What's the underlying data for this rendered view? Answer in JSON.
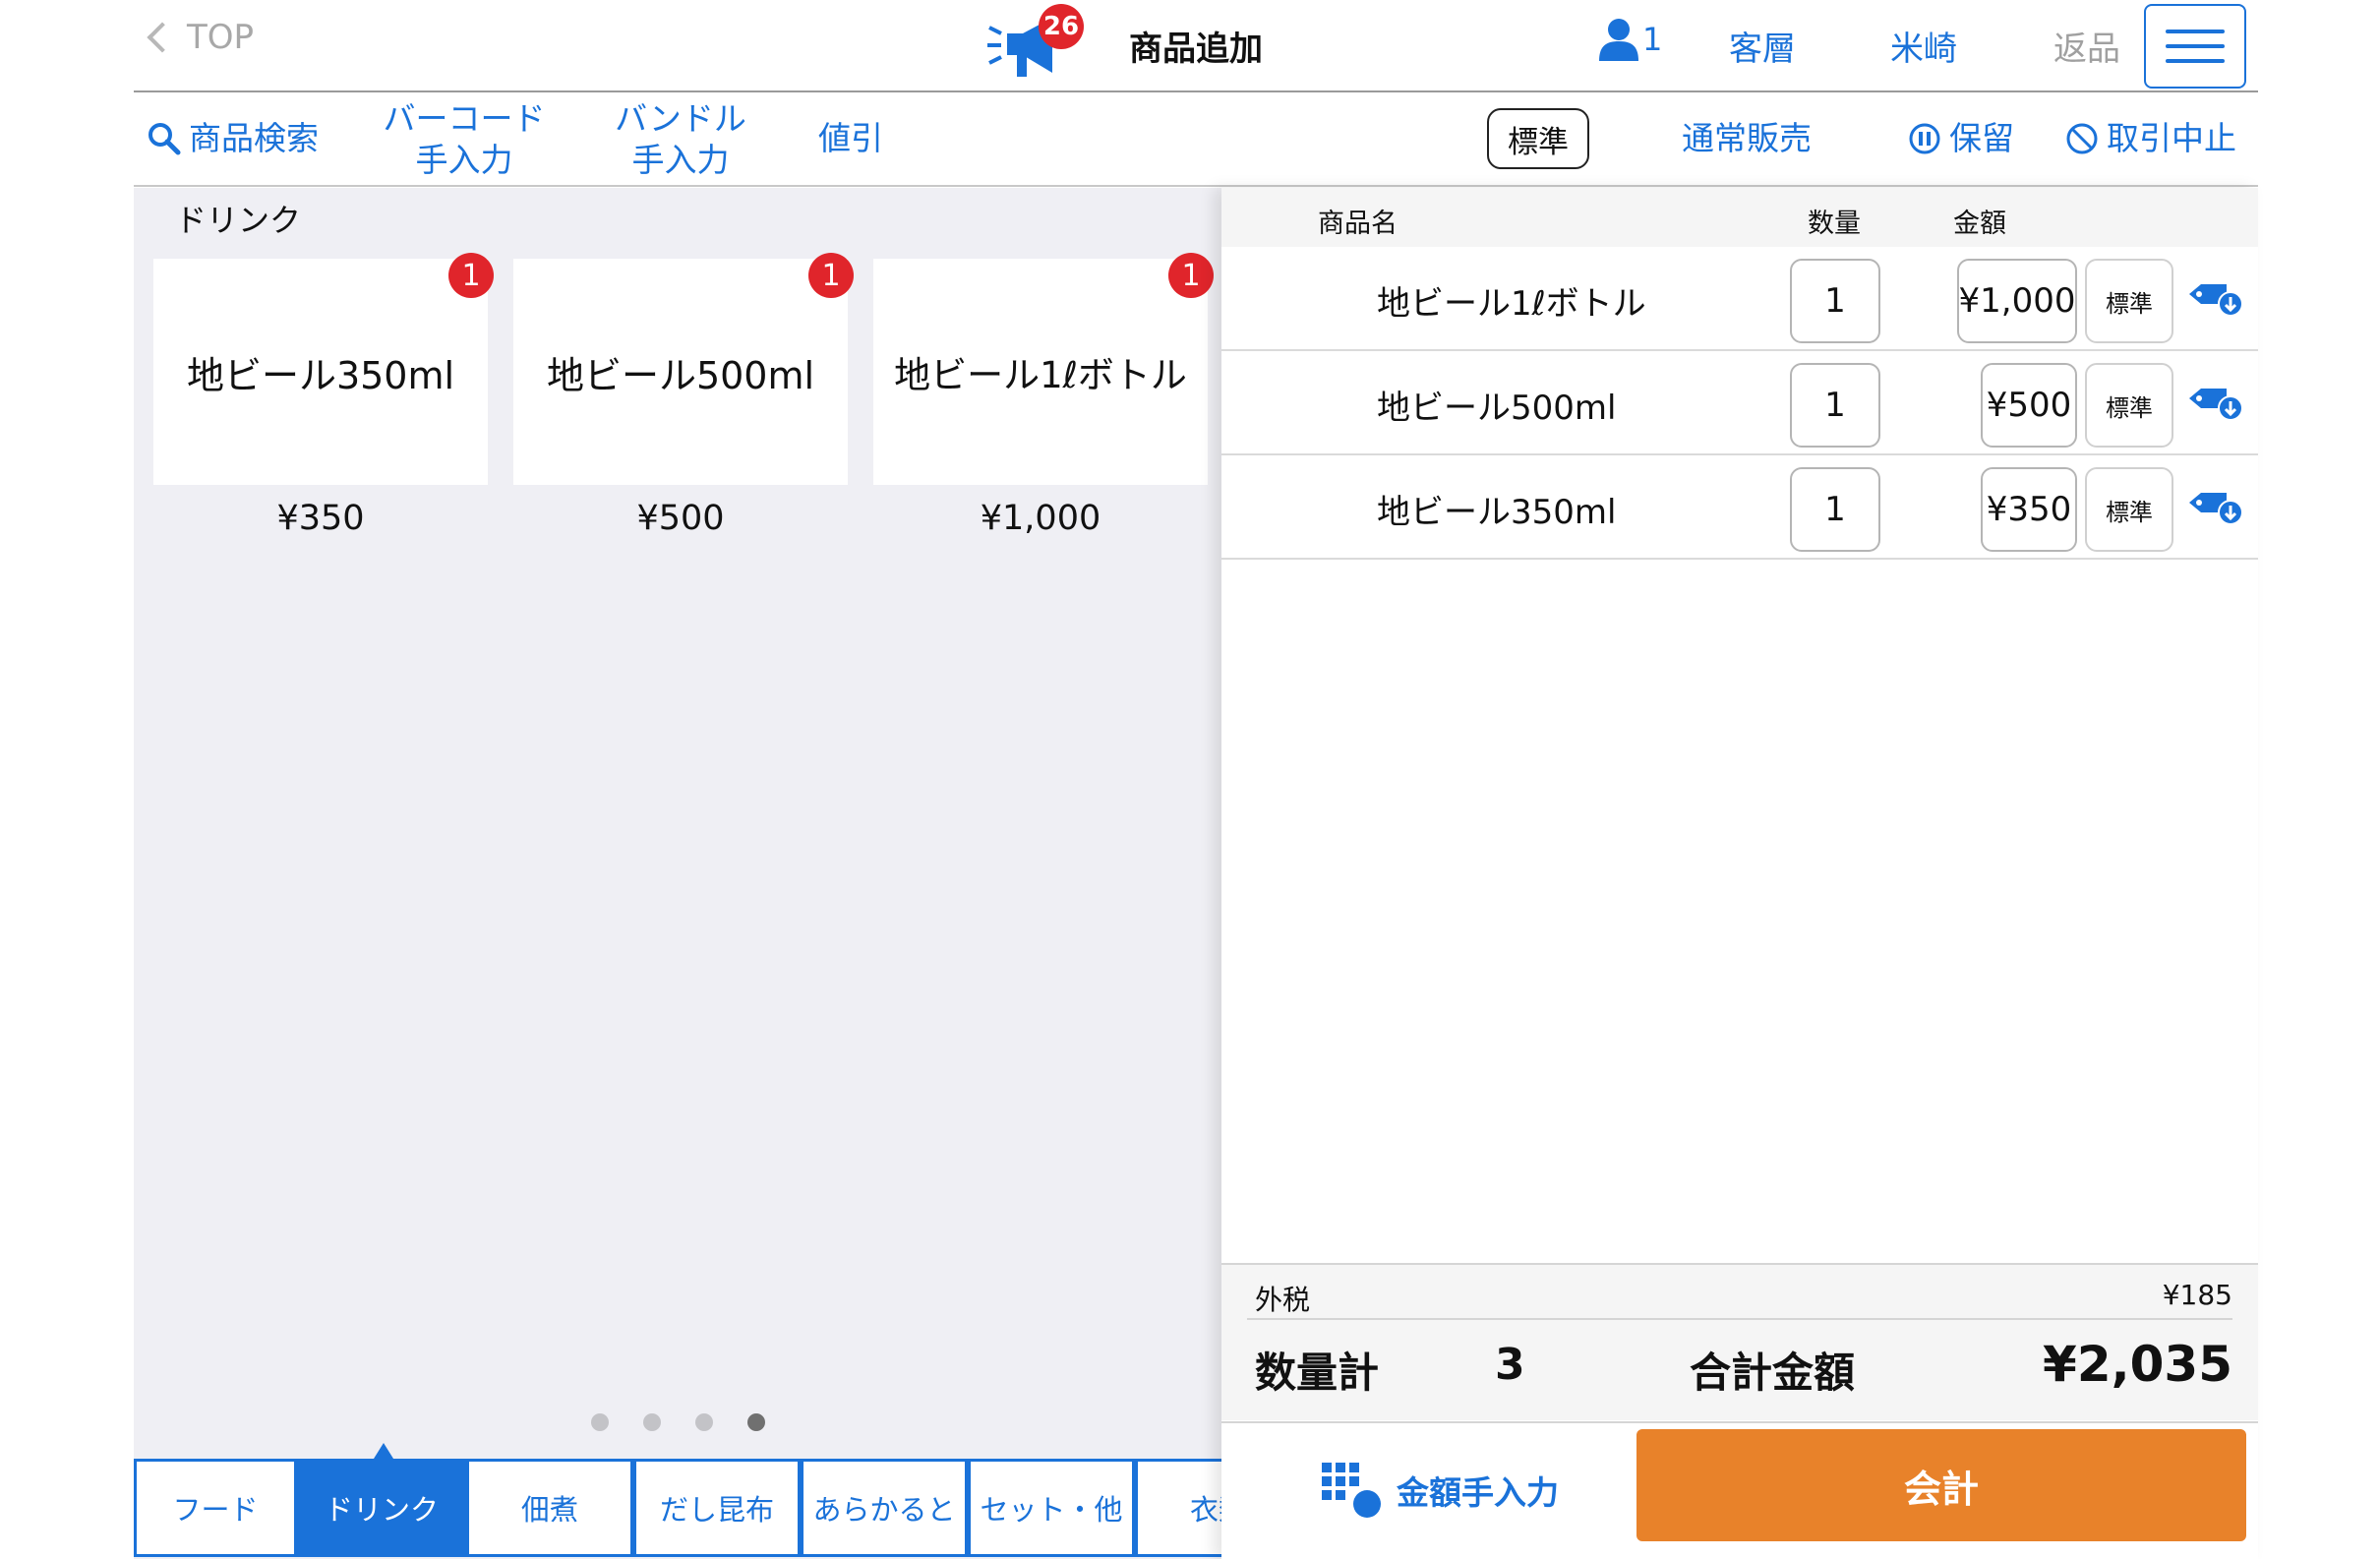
{
  "header": {
    "back_label": "TOP",
    "news_badge": "26",
    "title": "商品追加",
    "staff_count": "1",
    "customer_label": "客層",
    "staff_name": "米崎",
    "return_label": "返品"
  },
  "toolbar": {
    "search_label": "商品検索",
    "barcode_line1": "バーコード",
    "barcode_line2": "手入力",
    "bundle_line1": "バンドル",
    "bundle_line2": "手入力",
    "discount_label": "値引",
    "price_mode_label": "標準",
    "sale_type_label": "通常販売",
    "hold_label": "保留",
    "cancel_label": "取引中止"
  },
  "products": {
    "category_title": "ドリンク",
    "items": [
      {
        "name": "地ビール350ml",
        "price": "¥350",
        "count": "1"
      },
      {
        "name": "地ビール500ml",
        "price": "¥500",
        "count": "1"
      },
      {
        "name": "地ビール1ℓボトル",
        "price": "¥1,000",
        "count": "1"
      }
    ]
  },
  "categories": [
    {
      "label": "フード",
      "active": false
    },
    {
      "label": "ドリンク",
      "active": true
    },
    {
      "label": "佃煮",
      "active": false
    },
    {
      "label": "だし昆布",
      "active": false
    },
    {
      "label": "あらかると",
      "active": false
    },
    {
      "label": "セット・他",
      "active": false
    },
    {
      "label": "衣類",
      "active": false
    }
  ],
  "cart": {
    "col_name": "商品名",
    "col_qty": "数量",
    "col_amount": "金額",
    "rows": [
      {
        "name": "地ビール1ℓボトル",
        "qty": "1",
        "amount": "¥1,000",
        "price_mode": "標準"
      },
      {
        "name": "地ビール500ml",
        "qty": "1",
        "amount": "¥500",
        "price_mode": "標準"
      },
      {
        "name": "地ビール350ml",
        "qty": "1",
        "amount": "¥350",
        "price_mode": "標準"
      }
    ]
  },
  "summary": {
    "tax_label": "外税",
    "tax_value": "¥185",
    "qty_label": "数量計",
    "qty_value": "3",
    "total_label": "合計金額",
    "total_value": "¥2,035"
  },
  "actions": {
    "manual_amount_label": "金額手入力",
    "checkout_label": "会計"
  },
  "colors": {
    "accent": "#1a72d9",
    "badge": "#e0252b",
    "checkout": "#e8822a"
  }
}
